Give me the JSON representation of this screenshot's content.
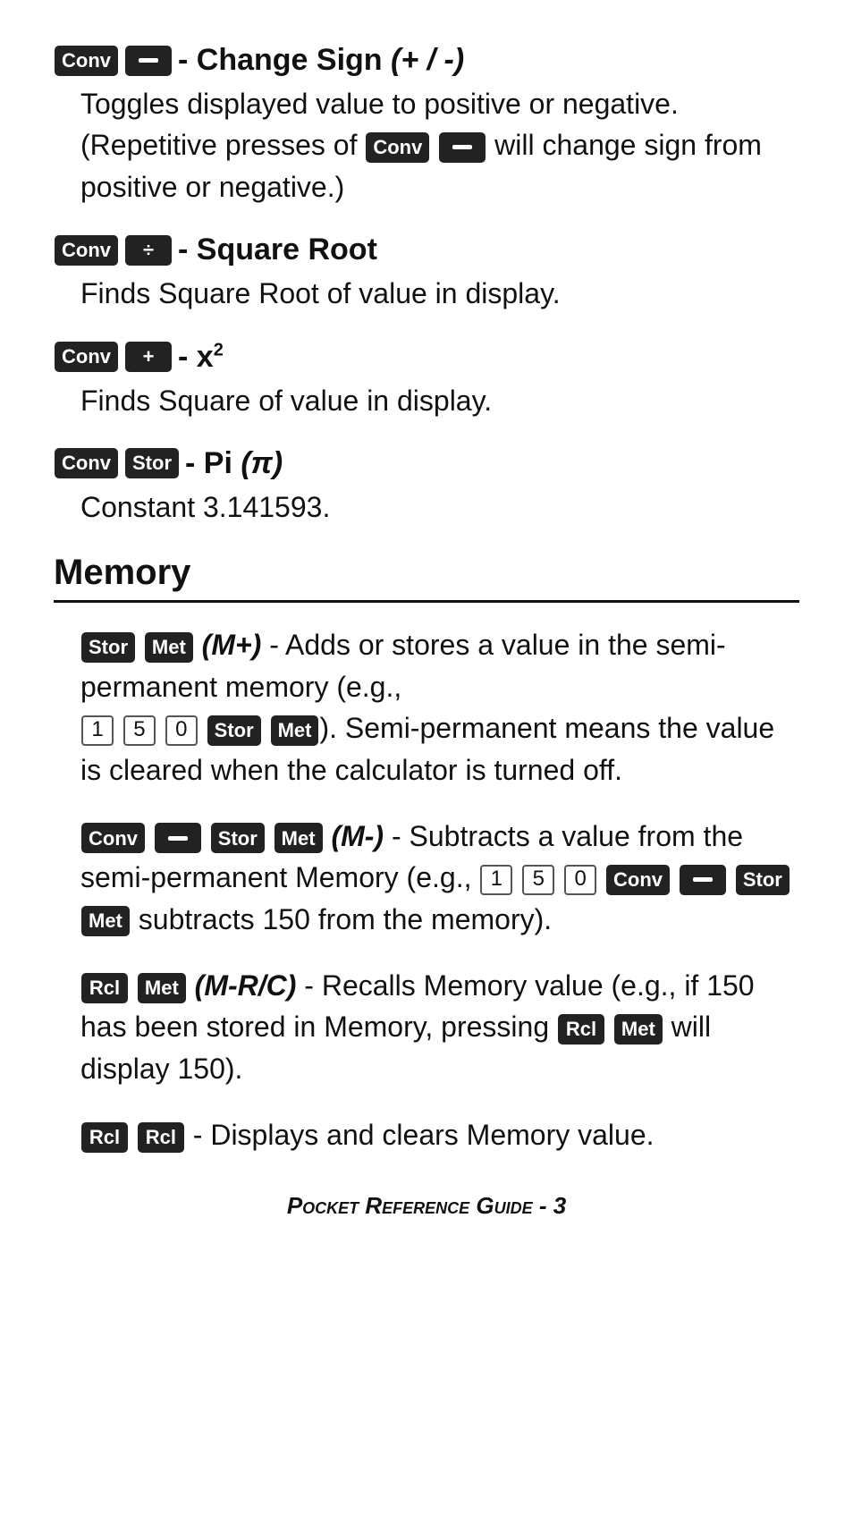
{
  "entries": [
    {
      "id": "change-sign",
      "title_pre_keys": [],
      "title_keys": [
        "Conv",
        "—"
      ],
      "title_text": "- Change Sign",
      "title_italic": "(+ / -)",
      "body": "Toggles displayed value to positive or negative. (Repetitive presses of",
      "body_keys_mid": [
        "Conv",
        "—"
      ],
      "body_text_end": "will change sign from positive or negative.)"
    },
    {
      "id": "square-root",
      "title_keys": [
        "Conv",
        "÷"
      ],
      "title_text": "- Square Root",
      "body": "Finds Square Root of value in display."
    },
    {
      "id": "x-squared",
      "title_keys": [
        "Conv",
        "+"
      ],
      "title_text": "- x²",
      "body": "Finds Square of value in display."
    },
    {
      "id": "pi",
      "title_keys": [
        "Conv",
        "Stor"
      ],
      "title_text": "- Pi",
      "title_italic": "(π)",
      "body": "Constant 3.141593."
    }
  ],
  "memory_heading": "Memory",
  "memory_entries": [
    {
      "id": "m-plus",
      "keys": [
        "Stor",
        "Met"
      ],
      "italic": "(M+)",
      "text_before": "- Adds or stores a value in the semi-permanent memory (e.g.,",
      "inline_keys": [
        "1",
        "5",
        "0",
        "Stor",
        "Met"
      ],
      "inline_key_types": [
        "num",
        "num",
        "num",
        "key",
        "key"
      ],
      "text_after": "). Semi-permanent means the value is cleared when the calculator is turned off."
    },
    {
      "id": "m-minus",
      "keys": [
        "Conv",
        "—",
        "Stor",
        "Met"
      ],
      "italic": "(M-)",
      "text_before": "- Subtracts a value from the semi-permanent Memory (e.g.,",
      "inline_keys": [
        "1",
        "5",
        "0",
        "Conv",
        "—",
        "Stor",
        "Met"
      ],
      "inline_key_types": [
        "num",
        "num",
        "num",
        "key",
        "key",
        "key",
        "key"
      ],
      "text_after": "subtracts 150 from the memory)."
    },
    {
      "id": "m-rc",
      "keys": [
        "Rcl",
        "Met"
      ],
      "italic": "(M-R/C)",
      "text_before": "- Recalls Memory value (e.g., if 150 has been stored in Memory, pressing",
      "inline_keys": [
        "Rcl",
        "Met"
      ],
      "inline_key_types": [
        "key",
        "key"
      ],
      "text_after": "will display 150)."
    },
    {
      "id": "rcl-rcl",
      "keys": [
        "Rcl",
        "Rcl"
      ],
      "text_before": "- Displays and clears Memory value."
    }
  ],
  "footer": "Pocket Reference Guide - 3",
  "key_labels": {
    "Conv": "Conv",
    "Stor": "Stor",
    "Met": "Met",
    "Rcl": "Rcl"
  }
}
